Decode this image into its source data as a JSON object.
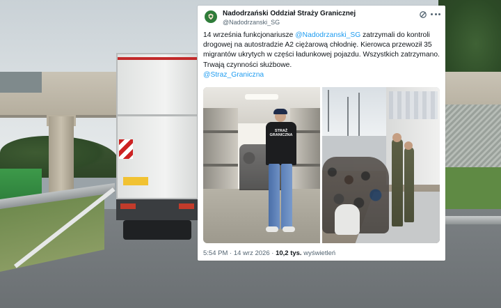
{
  "tweet": {
    "author_name": "Nadodrzański Oddział Straży Granicznej",
    "author_handle": "@Nadodrzanski_SG",
    "text_part1": "14 września funkcjonariusze ",
    "mention_1": "@Nadodrzanski_SG",
    "text_part2": " zatrzymali do kontroli drogowej na autostradzie A2 ciężarową chłodnię. Kierowca przewoził 35 migrantów ukrytych w części ładunkowej pojazdu. Wszystkich zatrzymano. Trwają czynności służbowe.",
    "mention_2": "@Straz_Graniczna",
    "time": "5:54 PM",
    "separator": "·",
    "date": "14 wrz 2026",
    "views_count": "10,2 tys.",
    "views_label": "wyświetleń"
  },
  "media": {
    "photo1_jacket_text": "STRAŻ GRANICZNA"
  },
  "colors": {
    "link": "#1d9bf0",
    "text": "#0f1419",
    "muted": "#536471",
    "avatar": "#2f7d3a"
  },
  "icons": [
    "emblem-icon",
    "grok-icon",
    "more-icon"
  ]
}
